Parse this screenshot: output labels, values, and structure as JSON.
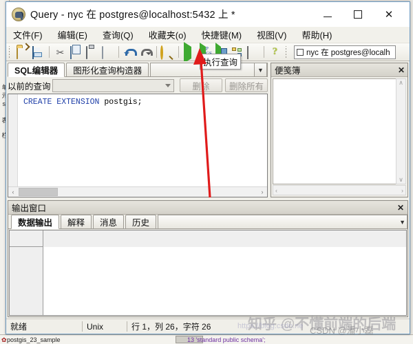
{
  "window": {
    "title": "Query - nyc 在  postgres@localhost:5432 上 *",
    "app_icon": "postgresql-elephant-icon",
    "minimize_label": "─",
    "maximize_label": "□",
    "close_label": "✕"
  },
  "menubar": {
    "items": [
      {
        "label": "文件(F)"
      },
      {
        "label": "编辑(E)"
      },
      {
        "label": "查询(Q)"
      },
      {
        "label": "收藏夹(o)"
      },
      {
        "label": "快捷键(M)"
      },
      {
        "label": "视图(V)"
      },
      {
        "label": "帮助(H)"
      }
    ]
  },
  "toolbar": {
    "buttons": [
      {
        "name": "open-file-icon"
      },
      {
        "name": "save-file-icon"
      },
      {
        "name": "cut-icon"
      },
      {
        "name": "copy-icon"
      },
      {
        "name": "paste-icon"
      },
      {
        "name": "clear-window-icon"
      },
      {
        "name": "undo-icon"
      },
      {
        "name": "redo-icon"
      },
      {
        "name": "find-replace-icon"
      },
      {
        "name": "execute-query-icon"
      },
      {
        "name": "execute-pgscript-icon"
      },
      {
        "name": "execute-to-file-icon"
      },
      {
        "name": "explain-query-icon"
      },
      {
        "name": "stop-icon"
      },
      {
        "name": "help-icon"
      }
    ],
    "pgscript_label_top": "P",
    "pgscript_label_bottom": "GS",
    "help_label": "?",
    "connection": "nyc 在  postgres@localh"
  },
  "tooltip": {
    "text": "执行查询"
  },
  "editor_panel": {
    "tabs": [
      {
        "label": "SQL编辑器",
        "active": true
      },
      {
        "label": "图形化查询构造器",
        "active": false
      }
    ],
    "dropdown_glyph": "▼",
    "previous_query_label": "以前的查询",
    "previous_query_value": "",
    "delete_label": "删除",
    "delete_all_label": "删除所有",
    "sql": {
      "keyword": "CREATE EXTENSION",
      "rest": " postgis;"
    },
    "hscroll_left": "‹",
    "hscroll_right": "›"
  },
  "scratch_pad": {
    "title": "便笺簿",
    "close_label": "✕",
    "content": "",
    "scroll_up": "∧",
    "scroll_down": "∨",
    "scroll_left": "‹",
    "scroll_right": "›"
  },
  "output_window": {
    "title": "输出窗口",
    "close_label": "✕",
    "tabs": [
      {
        "label": "数据输出",
        "active": true
      },
      {
        "label": "解释",
        "active": false
      },
      {
        "label": "消息",
        "active": false
      },
      {
        "label": "历史",
        "active": false
      }
    ],
    "dropdown_glyph": "▼",
    "grid": {
      "columns": [],
      "rows": []
    }
  },
  "statusbar": {
    "state": "就绪",
    "line_ending": "Unix",
    "cursor": "行 1，列 26，字符 26"
  },
  "background_window": {
    "left_labels": [
      "单",
      "元",
      "st",
      "表",
      "栏"
    ],
    "tree_item": "postgis_23_sample",
    "code_line": "13  'standard public schema';"
  },
  "watermarks": {
    "zhihu": "知乎 @不懂前端的后端",
    "csdn": "CSDN @潘小磊",
    "url": "https://blog.csdn.ne"
  },
  "colors": {
    "accent": "#6d9bc3",
    "keyword": "#1f3fa8",
    "play_green": "#3faa32",
    "annotation_red": "#e01b1b"
  }
}
